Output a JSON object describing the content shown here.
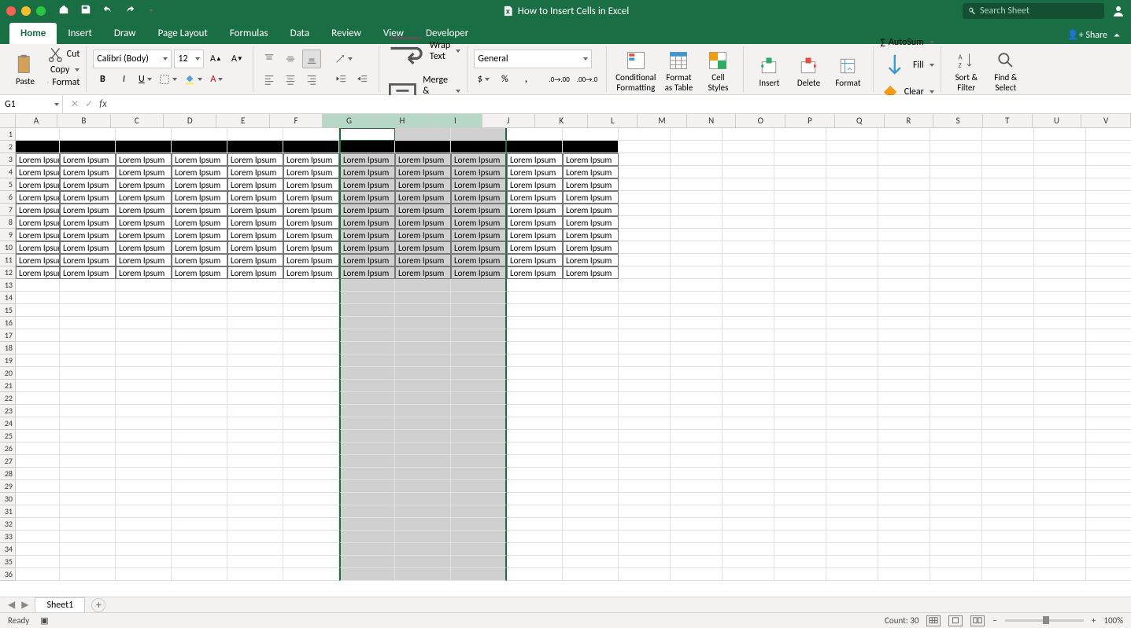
{
  "title": "How to Insert Cells in Excel",
  "search_placeholder": "Search Sheet",
  "tabs": [
    "Home",
    "Insert",
    "Draw",
    "Page Layout",
    "Formulas",
    "Data",
    "Review",
    "View",
    "Developer"
  ],
  "share": "Share",
  "ribbon": {
    "cut": "Cut",
    "copy": "Copy",
    "format": "Format",
    "paste": "Paste",
    "font_name": "Calibri (Body)",
    "font_size": "12",
    "wrap": "Wrap Text",
    "merge": "Merge & Center",
    "number_format": "General",
    "conditional": "Conditional",
    "formatting": "Formatting",
    "format_as": "Format",
    "as_table": "as Table",
    "cell": "Cell",
    "styles": "Styles",
    "insert": "Insert",
    "delete": "Delete",
    "formatc": "Format",
    "autosum": "AutoSum",
    "fill": "Fill",
    "clear": "Clear",
    "sort": "Sort &",
    "filter": "Filter",
    "find": "Find &",
    "select": "Select"
  },
  "namebox": "G1",
  "columns": [
    "A",
    "B",
    "C",
    "D",
    "E",
    "F",
    "G",
    "H",
    "I",
    "J",
    "K",
    "L",
    "M",
    "N",
    "O",
    "P",
    "Q",
    "R",
    "S",
    "T",
    "U",
    "V"
  ],
  "selected_cols": [
    "G",
    "H",
    "I"
  ],
  "data_cols": [
    "A",
    "B",
    "C",
    "D",
    "E",
    "F",
    "G",
    "H",
    "I",
    "J",
    "K"
  ],
  "row_count": 36,
  "black_row": 2,
  "data_rows": [
    3,
    4,
    5,
    6,
    7,
    8,
    9,
    10,
    11,
    12
  ],
  "cell_text": "Lorem Ipsum",
  "sheet_name": "Sheet1",
  "status_ready": "Ready",
  "status_count": "Count: 30",
  "zoom": "100%"
}
